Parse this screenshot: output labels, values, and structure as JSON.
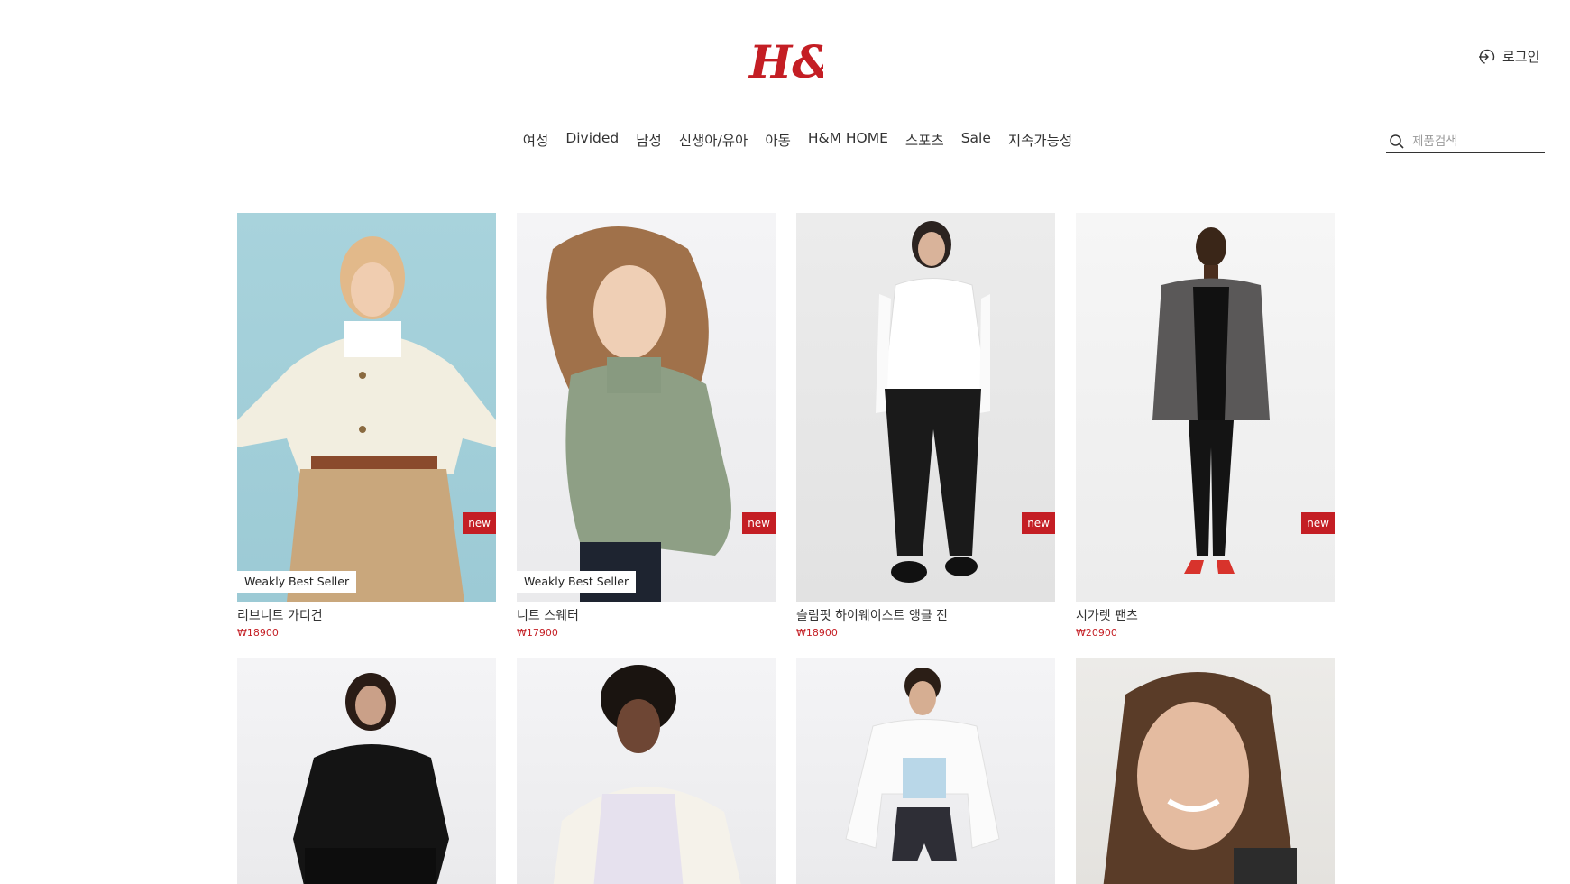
{
  "header": {
    "logo_text": "H&M",
    "login_label": "로그인",
    "brand_color": "#c41e24"
  },
  "nav": {
    "items": [
      {
        "label": "여성"
      },
      {
        "label": "Divided"
      },
      {
        "label": "남성"
      },
      {
        "label": "신생아/유아"
      },
      {
        "label": "아동"
      },
      {
        "label": "H&M HOME"
      },
      {
        "label": "스포츠"
      },
      {
        "label": "Sale"
      },
      {
        "label": "지속가능성"
      }
    ]
  },
  "search": {
    "placeholder": "제품검색",
    "value": ""
  },
  "products": [
    {
      "name": "리브니트 가디건",
      "price": "₩18900",
      "badge_new": "new",
      "badge_best": "Weakly Best Seller",
      "image": "woman-cream-cardigan-beige-pants"
    },
    {
      "name": "니트 스웨터",
      "price": "₩17900",
      "badge_new": "new",
      "badge_best": "Weakly Best Seller",
      "image": "woman-green-knit-sweater"
    },
    {
      "name": "슬림핏 하이웨이스트 앵클 진",
      "price": "₩18900",
      "badge_new": "new",
      "image": "woman-white-shirt-black-jeans"
    },
    {
      "name": "시가렛 팬츠",
      "price": "₩20900",
      "badge_new": "new",
      "image": "woman-grey-blazer-black-pants"
    },
    {
      "image": "woman-black-hoodie"
    },
    {
      "image": "woman-white-zip-hoodie"
    },
    {
      "image": "woman-white-shirt-denim-shorts"
    },
    {
      "image": "woman-portrait-smiling"
    }
  ]
}
